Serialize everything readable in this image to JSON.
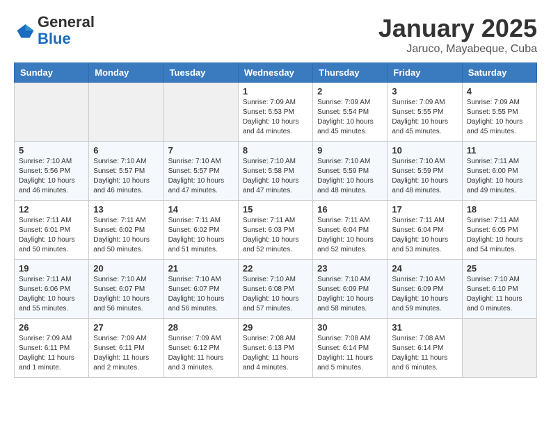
{
  "header": {
    "logo_general": "General",
    "logo_blue": "Blue",
    "month_title": "January 2025",
    "location": "Jaruco, Mayabeque, Cuba"
  },
  "weekdays": [
    "Sunday",
    "Monday",
    "Tuesday",
    "Wednesday",
    "Thursday",
    "Friday",
    "Saturday"
  ],
  "weeks": [
    [
      {
        "day": "",
        "info": ""
      },
      {
        "day": "",
        "info": ""
      },
      {
        "day": "",
        "info": ""
      },
      {
        "day": "1",
        "info": "Sunrise: 7:09 AM\nSunset: 5:53 PM\nDaylight: 10 hours\nand 44 minutes."
      },
      {
        "day": "2",
        "info": "Sunrise: 7:09 AM\nSunset: 5:54 PM\nDaylight: 10 hours\nand 45 minutes."
      },
      {
        "day": "3",
        "info": "Sunrise: 7:09 AM\nSunset: 5:55 PM\nDaylight: 10 hours\nand 45 minutes."
      },
      {
        "day": "4",
        "info": "Sunrise: 7:09 AM\nSunset: 5:55 PM\nDaylight: 10 hours\nand 45 minutes."
      }
    ],
    [
      {
        "day": "5",
        "info": "Sunrise: 7:10 AM\nSunset: 5:56 PM\nDaylight: 10 hours\nand 46 minutes."
      },
      {
        "day": "6",
        "info": "Sunrise: 7:10 AM\nSunset: 5:57 PM\nDaylight: 10 hours\nand 46 minutes."
      },
      {
        "day": "7",
        "info": "Sunrise: 7:10 AM\nSunset: 5:57 PM\nDaylight: 10 hours\nand 47 minutes."
      },
      {
        "day": "8",
        "info": "Sunrise: 7:10 AM\nSunset: 5:58 PM\nDaylight: 10 hours\nand 47 minutes."
      },
      {
        "day": "9",
        "info": "Sunrise: 7:10 AM\nSunset: 5:59 PM\nDaylight: 10 hours\nand 48 minutes."
      },
      {
        "day": "10",
        "info": "Sunrise: 7:10 AM\nSunset: 5:59 PM\nDaylight: 10 hours\nand 48 minutes."
      },
      {
        "day": "11",
        "info": "Sunrise: 7:11 AM\nSunset: 6:00 PM\nDaylight: 10 hours\nand 49 minutes."
      }
    ],
    [
      {
        "day": "12",
        "info": "Sunrise: 7:11 AM\nSunset: 6:01 PM\nDaylight: 10 hours\nand 50 minutes."
      },
      {
        "day": "13",
        "info": "Sunrise: 7:11 AM\nSunset: 6:02 PM\nDaylight: 10 hours\nand 50 minutes."
      },
      {
        "day": "14",
        "info": "Sunrise: 7:11 AM\nSunset: 6:02 PM\nDaylight: 10 hours\nand 51 minutes."
      },
      {
        "day": "15",
        "info": "Sunrise: 7:11 AM\nSunset: 6:03 PM\nDaylight: 10 hours\nand 52 minutes."
      },
      {
        "day": "16",
        "info": "Sunrise: 7:11 AM\nSunset: 6:04 PM\nDaylight: 10 hours\nand 52 minutes."
      },
      {
        "day": "17",
        "info": "Sunrise: 7:11 AM\nSunset: 6:04 PM\nDaylight: 10 hours\nand 53 minutes."
      },
      {
        "day": "18",
        "info": "Sunrise: 7:11 AM\nSunset: 6:05 PM\nDaylight: 10 hours\nand 54 minutes."
      }
    ],
    [
      {
        "day": "19",
        "info": "Sunrise: 7:11 AM\nSunset: 6:06 PM\nDaylight: 10 hours\nand 55 minutes."
      },
      {
        "day": "20",
        "info": "Sunrise: 7:10 AM\nSunset: 6:07 PM\nDaylight: 10 hours\nand 56 minutes."
      },
      {
        "day": "21",
        "info": "Sunrise: 7:10 AM\nSunset: 6:07 PM\nDaylight: 10 hours\nand 56 minutes."
      },
      {
        "day": "22",
        "info": "Sunrise: 7:10 AM\nSunset: 6:08 PM\nDaylight: 10 hours\nand 57 minutes."
      },
      {
        "day": "23",
        "info": "Sunrise: 7:10 AM\nSunset: 6:09 PM\nDaylight: 10 hours\nand 58 minutes."
      },
      {
        "day": "24",
        "info": "Sunrise: 7:10 AM\nSunset: 6:09 PM\nDaylight: 10 hours\nand 59 minutes."
      },
      {
        "day": "25",
        "info": "Sunrise: 7:10 AM\nSunset: 6:10 PM\nDaylight: 11 hours\nand 0 minutes."
      }
    ],
    [
      {
        "day": "26",
        "info": "Sunrise: 7:09 AM\nSunset: 6:11 PM\nDaylight: 11 hours\nand 1 minute."
      },
      {
        "day": "27",
        "info": "Sunrise: 7:09 AM\nSunset: 6:11 PM\nDaylight: 11 hours\nand 2 minutes."
      },
      {
        "day": "28",
        "info": "Sunrise: 7:09 AM\nSunset: 6:12 PM\nDaylight: 11 hours\nand 3 minutes."
      },
      {
        "day": "29",
        "info": "Sunrise: 7:08 AM\nSunset: 6:13 PM\nDaylight: 11 hours\nand 4 minutes."
      },
      {
        "day": "30",
        "info": "Sunrise: 7:08 AM\nSunset: 6:14 PM\nDaylight: 11 hours\nand 5 minutes."
      },
      {
        "day": "31",
        "info": "Sunrise: 7:08 AM\nSunset: 6:14 PM\nDaylight: 11 hours\nand 6 minutes."
      },
      {
        "day": "",
        "info": ""
      }
    ]
  ]
}
